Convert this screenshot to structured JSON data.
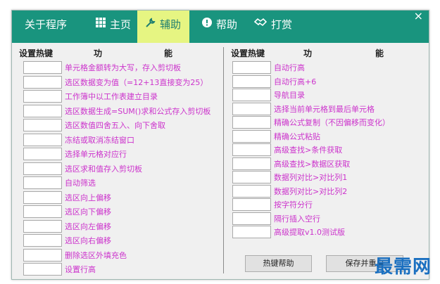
{
  "header": {
    "tabs": [
      {
        "label": "关于程序",
        "icon": "none",
        "active": false
      },
      {
        "label": "主页",
        "icon": "grid-icon",
        "active": false
      },
      {
        "label": "辅助",
        "icon": "wrench-icon",
        "active": true
      },
      {
        "label": "帮助",
        "icon": "info-icon",
        "active": false
      },
      {
        "label": "打赏",
        "icon": "handshake-icon",
        "active": false
      }
    ],
    "close_label": "×"
  },
  "left": {
    "col_key": "设置热键",
    "col_func_a": "功",
    "col_func_b": "能",
    "items": [
      "单元格金额转为大写，存入剪切板",
      "选区数据变为值（=12+13直接变为25）",
      "工作簿中以工作表建立目录",
      "选区数据生成=SUM()求和公式存入剪切板",
      "选区数值四舍五入、向下舍取",
      "冻结或取消冻结窗口",
      "选择单元格对应行",
      "选区求和值存入剪切板",
      "自动筛选",
      "选区向上偏移",
      "选区向下偏移",
      "选区向左偏移",
      "选区向右偏移",
      "删除选区外填充色",
      "设置行高"
    ]
  },
  "right": {
    "col_key": "设置热键",
    "col_func_a": "功",
    "col_func_b": "能",
    "items": [
      "自动行高",
      "自动行高+6",
      "导航目录",
      "选择当前单元格到最后单元格",
      "精确公式复制（不因偏移而变化）",
      "精确公式粘贴",
      "高级查找>条件获取",
      "高级查找>数据区获取",
      "数据列对比>对比列1",
      "数据列对比>对比列2",
      "按字符分行",
      "隔行插入空行",
      "高级提取v1.0测试版"
    ]
  },
  "buttons": {
    "hotkey_help": "热键帮助",
    "save": "保存并重启"
  },
  "watermark": "最需网"
}
